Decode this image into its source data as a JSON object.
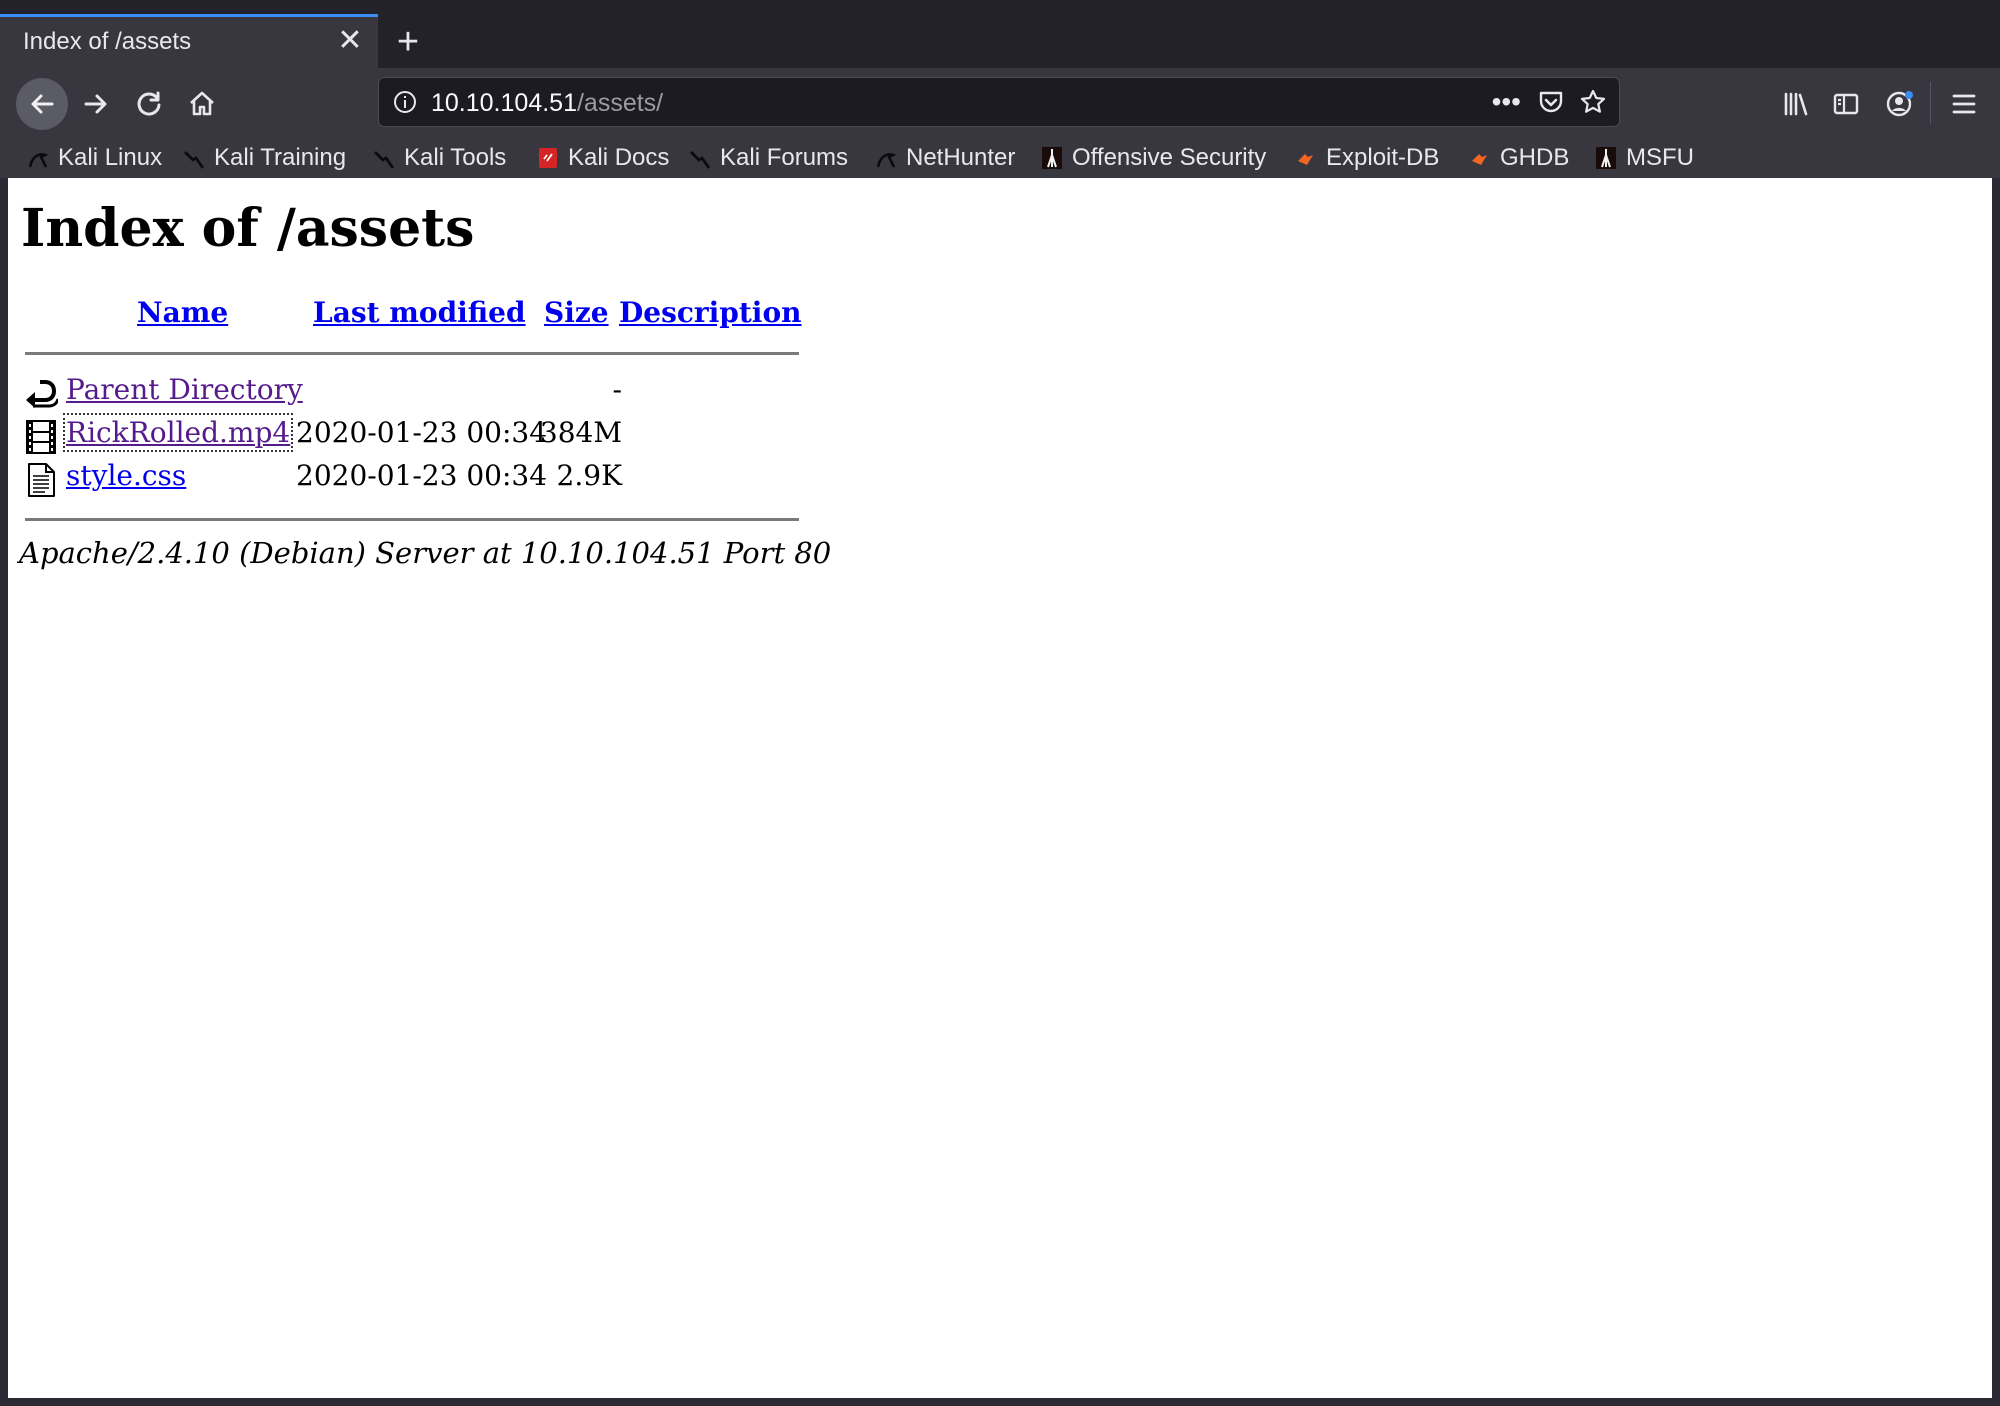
{
  "browser": {
    "tab": {
      "title": "Index of /assets"
    },
    "url": {
      "host": "10.10.104.51",
      "path": "/assets/"
    },
    "accent_color": "#3b8cf5",
    "bookmarks": [
      {
        "label": "Kali Linux",
        "icon": "kali-dragon-icon"
      },
      {
        "label": "Kali Training",
        "icon": "kali-dragon-icon"
      },
      {
        "label": "Kali Tools",
        "icon": "kali-dragon-icon"
      },
      {
        "label": "Kali Docs",
        "icon": "kali-docs-icon"
      },
      {
        "label": "Kali Forums",
        "icon": "kali-dragon-icon"
      },
      {
        "label": "NetHunter",
        "icon": "kali-dragon-icon"
      },
      {
        "label": "Offensive Security",
        "icon": "offsec-icon"
      },
      {
        "label": "Exploit-DB",
        "icon": "exploitdb-icon"
      },
      {
        "label": "GHDB",
        "icon": "exploitdb-icon"
      },
      {
        "label": "MSFU",
        "icon": "offsec-icon"
      }
    ]
  },
  "page": {
    "title": "Index of /assets",
    "columns": [
      "Name",
      "Last modified",
      "Size",
      "Description"
    ],
    "rows": [
      {
        "name": "Parent Directory",
        "modified": "",
        "size": "-",
        "description": "",
        "icon": "back-arrow-icon"
      },
      {
        "name": "RickRolled.mp4",
        "modified": "2020-01-23 00:34",
        "size": "384M",
        "description": "",
        "icon": "movie-file-icon"
      },
      {
        "name": "style.css",
        "modified": "2020-01-23 00:34",
        "size": "2.9K",
        "description": "",
        "icon": "text-file-icon"
      }
    ],
    "address": "Apache/2.4.10 (Debian) Server at 10.10.104.51 Port 80"
  }
}
